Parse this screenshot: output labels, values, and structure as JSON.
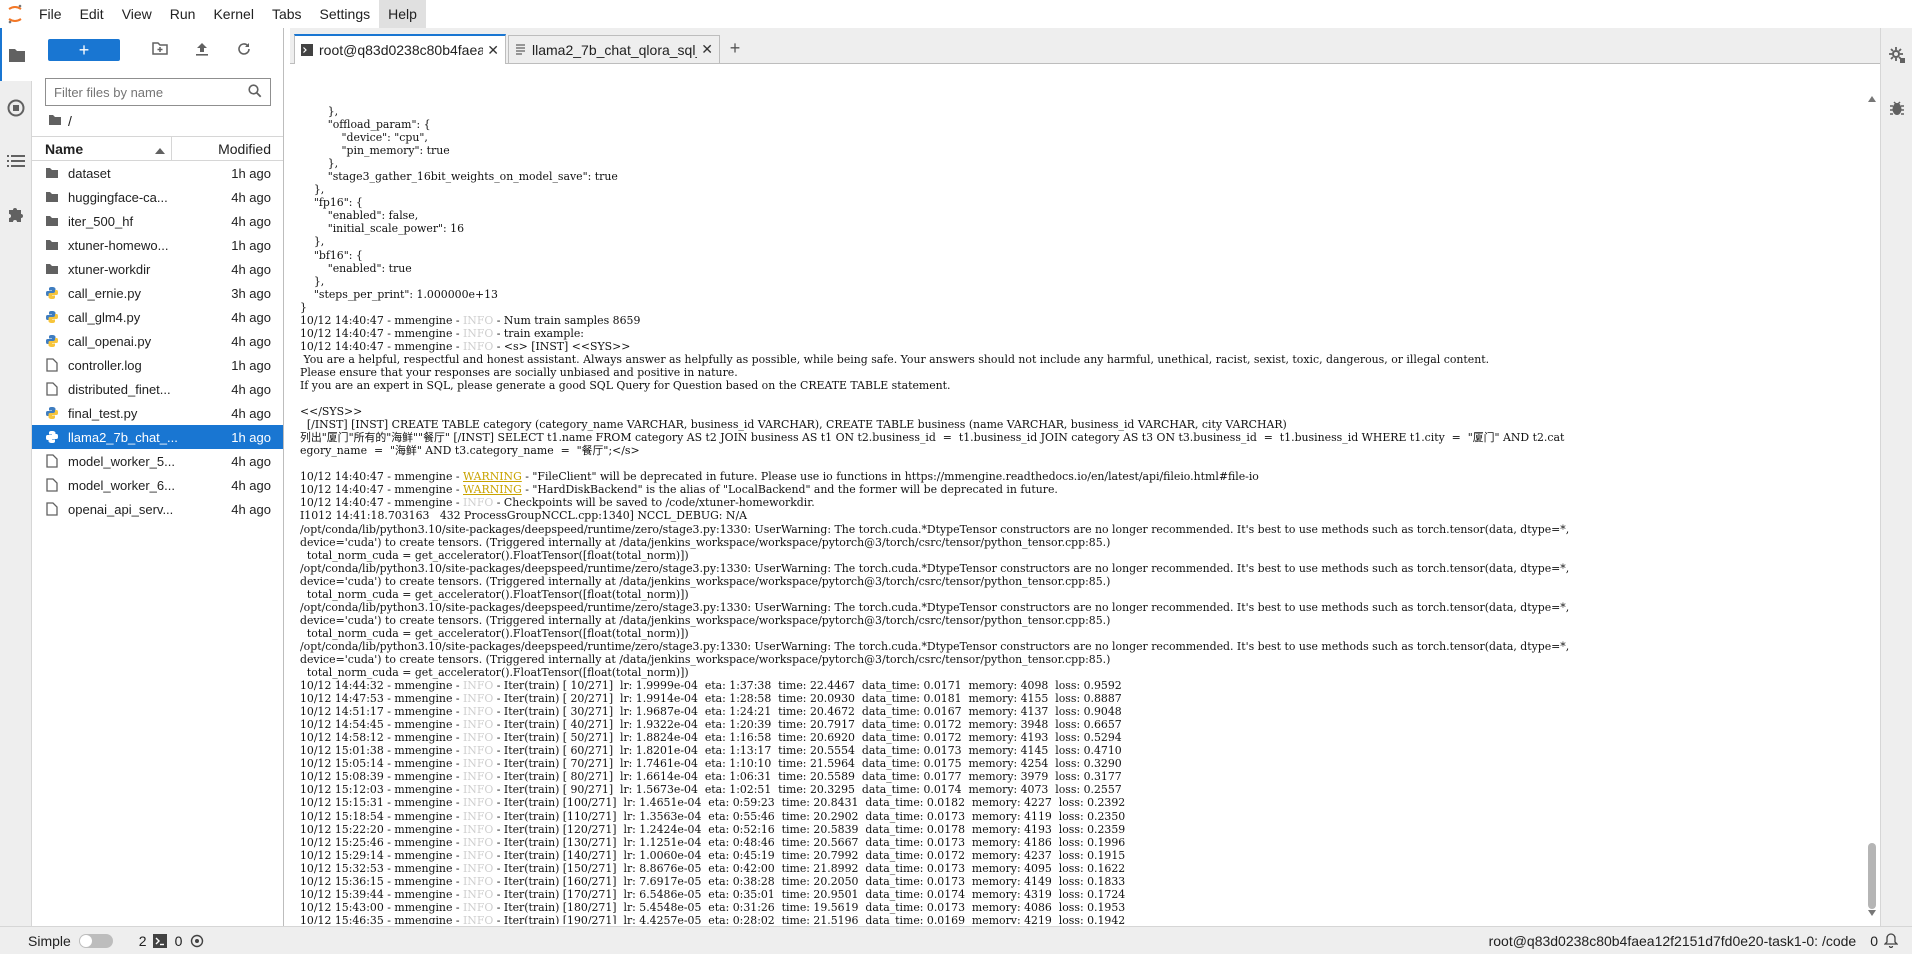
{
  "menu": [
    "File",
    "Edit",
    "View",
    "Run",
    "Kernel",
    "Tabs",
    "Settings",
    "Help"
  ],
  "file_browser": {
    "new_button": "+",
    "filter_placeholder": "Filter files by name",
    "breadcrumb": "/",
    "col_name": "Name",
    "col_modified": "Modified",
    "items": [
      {
        "name": "dataset",
        "type": "folder",
        "modified": "1h ago"
      },
      {
        "name": "huggingface-ca...",
        "type": "folder",
        "modified": "4h ago"
      },
      {
        "name": "iter_500_hf",
        "type": "folder",
        "modified": "4h ago"
      },
      {
        "name": "xtuner-homewo...",
        "type": "folder",
        "modified": "1h ago"
      },
      {
        "name": "xtuner-workdir",
        "type": "folder",
        "modified": "4h ago"
      },
      {
        "name": "call_ernie.py",
        "type": "python",
        "modified": "3h ago"
      },
      {
        "name": "call_glm4.py",
        "type": "python",
        "modified": "4h ago"
      },
      {
        "name": "call_openai.py",
        "type": "python",
        "modified": "4h ago"
      },
      {
        "name": "controller.log",
        "type": "file",
        "modified": "1h ago"
      },
      {
        "name": "distributed_finet...",
        "type": "file",
        "modified": "4h ago"
      },
      {
        "name": "final_test.py",
        "type": "python",
        "modified": "4h ago"
      },
      {
        "name": "llama2_7b_chat_...",
        "type": "python",
        "modified": "1h ago",
        "selected": true
      },
      {
        "name": "model_worker_5...",
        "type": "file",
        "modified": "4h ago"
      },
      {
        "name": "model_worker_6...",
        "type": "file",
        "modified": "4h ago"
      },
      {
        "name": "openai_api_serv...",
        "type": "file",
        "modified": "4h ago"
      }
    ]
  },
  "tabs": [
    {
      "label": "root@q83d0238c80b4faea",
      "type": "terminal",
      "active": true
    },
    {
      "label": "llama2_7b_chat_qlora_sql_",
      "type": "text",
      "active": false
    }
  ],
  "tab_add": "+",
  "terminal_lines": [
    "        },",
    "        \"offload_param\": {",
    "            \"device\": \"cpu\",",
    "            \"pin_memory\": true",
    "        },",
    "        \"stage3_gather_16bit_weights_on_model_save\": true",
    "    },",
    "    \"fp16\": {",
    "        \"enabled\": false,",
    "        \"initial_scale_power\": 16",
    "    },",
    "    \"bf16\": {",
    "        \"enabled\": true",
    "    },",
    "    \"steps_per_print\": 1.000000e+13",
    "}",
    "10/12 14:40:47 - mmengine - [[INFO]] - Num train samples 8659",
    "10/12 14:40:47 - mmengine - [[INFO]] - train example:",
    "10/12 14:40:47 - mmengine - [[INFO]] - <s> [INST] <<SYS>>",
    " You are a helpful, respectful and honest assistant. Always answer as helpfully as possible, while being safe. Your answers should not include any harmful, unethical, racist, sexist, toxic, dangerous, or illegal content.",
    "Please ensure that your responses are socially unbiased and positive in nature.",
    "If you are an expert in SQL, please generate a good SQL Query for Question based on the CREATE TABLE statement.",
    "",
    "<</SYS>>",
    "  [/INST] [INST] CREATE TABLE category (category_name VARCHAR, business_id VARCHAR), CREATE TABLE business (name VARCHAR, business_id VARCHAR, city VARCHAR)",
    "列出\"厦门\"所有的\"海鲜\"\"餐厅\" [/INST] SELECT t1.name FROM category AS t2 JOIN business AS t1 ON t2.business_id  =  t1.business_id JOIN category AS t3 ON t3.business_id  =  t1.business_id WHERE t1.city  =  \"厦门\" AND t2.cat",
    "egory_name  =  \"海鲜\" AND t3.category_name  =  \"餐厅\";</s>",
    "",
    "10/12 14:40:47 - mmengine - [[WARNING]] - \"FileClient\" will be deprecated in future. Please use io functions in https://mmengine.readthedocs.io/en/latest/api/fileio.html#file-io",
    "10/12 14:40:47 - mmengine - [[WARNING]] - \"HardDiskBackend\" is the alias of \"LocalBackend\" and the former will be deprecated in future.",
    "10/12 14:40:47 - mmengine - [[INFO]] - Checkpoints will be saved to /code/xtuner-homeworkdir.",
    "I1012 14:41:18.703163   432 ProcessGroupNCCL.cpp:1340] NCCL_DEBUG: N/A",
    "/opt/conda/lib/python3.10/site-packages/deepspeed/runtime/zero/stage3.py:1330: UserWarning: The torch.cuda.*DtypeTensor constructors are no longer recommended. It's best to use methods such as torch.tensor(data, dtype=*,",
    "device='cuda') to create tensors. (Triggered internally at /data/jenkins_workspace/workspace/pytorch@3/torch/csrc/tensor/python_tensor.cpp:85.)",
    "  total_norm_cuda = get_accelerator().FloatTensor([float(total_norm)])",
    "/opt/conda/lib/python3.10/site-packages/deepspeed/runtime/zero/stage3.py:1330: UserWarning: The torch.cuda.*DtypeTensor constructors are no longer recommended. It's best to use methods such as torch.tensor(data, dtype=*,",
    "device='cuda') to create tensors. (Triggered internally at /data/jenkins_workspace/workspace/pytorch@3/torch/csrc/tensor/python_tensor.cpp:85.)",
    "  total_norm_cuda = get_accelerator().FloatTensor([float(total_norm)])",
    "/opt/conda/lib/python3.10/site-packages/deepspeed/runtime/zero/stage3.py:1330: UserWarning: The torch.cuda.*DtypeTensor constructors are no longer recommended. It's best to use methods such as torch.tensor(data, dtype=*,",
    "device='cuda') to create tensors. (Triggered internally at /data/jenkins_workspace/workspace/pytorch@3/torch/csrc/tensor/python_tensor.cpp:85.)",
    "  total_norm_cuda = get_accelerator().FloatTensor([float(total_norm)])",
    "/opt/conda/lib/python3.10/site-packages/deepspeed/runtime/zero/stage3.py:1330: UserWarning: The torch.cuda.*DtypeTensor constructors are no longer recommended. It's best to use methods such as torch.tensor(data, dtype=*,",
    "device='cuda') to create tensors. (Triggered internally at /data/jenkins_workspace/workspace/pytorch@3/torch/csrc/tensor/python_tensor.cpp:85.)",
    "  total_norm_cuda = get_accelerator().FloatTensor([float(total_norm)])",
    "10/12 14:44:32 - mmengine - [[INFO]] - Iter(train) [ 10/271]  lr: 1.9999e-04  eta: 1:37:38  time: 22.4467  data_time: 0.0171  memory: 4098  loss: 0.9592",
    "10/12 14:47:53 - mmengine - [[INFO]] - Iter(train) [ 20/271]  lr: 1.9914e-04  eta: 1:28:58  time: 20.0930  data_time: 0.0181  memory: 4155  loss: 0.8887",
    "10/12 14:51:17 - mmengine - [[INFO]] - Iter(train) [ 30/271]  lr: 1.9687e-04  eta: 1:24:21  time: 20.4672  data_time: 0.0167  memory: 4137  loss: 0.9048",
    "10/12 14:54:45 - mmengine - [[INFO]] - Iter(train) [ 40/271]  lr: 1.9322e-04  eta: 1:20:39  time: 20.7917  data_time: 0.0172  memory: 3948  loss: 0.6657",
    "10/12 14:58:12 - mmengine - [[INFO]] - Iter(train) [ 50/271]  lr: 1.8824e-04  eta: 1:16:58  time: 20.6920  data_time: 0.0172  memory: 4193  loss: 0.5294",
    "10/12 15:01:38 - mmengine - [[INFO]] - Iter(train) [ 60/271]  lr: 1.8201e-04  eta: 1:13:17  time: 20.5554  data_time: 0.0173  memory: 4145  loss: 0.4710",
    "10/12 15:05:14 - mmengine - [[INFO]] - Iter(train) [ 70/271]  lr: 1.7461e-04  eta: 1:10:10  time: 21.5964  data_time: 0.0175  memory: 4254  loss: 0.3290",
    "10/12 15:08:39 - mmengine - [[INFO]] - Iter(train) [ 80/271]  lr: 1.6614e-04  eta: 1:06:31  time: 20.5589  data_time: 0.0177  memory: 3979  loss: 0.3177",
    "10/12 15:12:03 - mmengine - [[INFO]] - Iter(train) [ 90/271]  lr: 1.5673e-04  eta: 1:02:51  time: 20.3295  data_time: 0.0174  memory: 4073  loss: 0.2557",
    "10/12 15:15:31 - mmengine - [[INFO]] - Iter(train) [100/271]  lr: 1.4651e-04  eta: 0:59:23  time: 20.8431  data_time: 0.0182  memory: 4227  loss: 0.2392",
    "10/12 15:18:54 - mmengine - [[INFO]] - Iter(train) [110/271]  lr: 1.3563e-04  eta: 0:55:46  time: 20.2902  data_time: 0.0173  memory: 4119  loss: 0.2350",
    "10/12 15:22:20 - mmengine - [[INFO]] - Iter(train) [120/271]  lr: 1.2424e-04  eta: 0:52:16  time: 20.5839  data_time: 0.0178  memory: 4193  loss: 0.2359",
    "10/12 15:25:46 - mmengine - [[INFO]] - Iter(train) [130/271]  lr: 1.1251e-04  eta: 0:48:46  time: 20.5667  data_time: 0.0173  memory: 4186  loss: 0.1996",
    "10/12 15:29:14 - mmengine - [[INFO]] - Iter(train) [140/271]  lr: 1.0060e-04  eta: 0:45:19  time: 20.7992  data_time: 0.0172  memory: 4237  loss: 0.1915",
    "10/12 15:32:53 - mmengine - [[INFO]] - Iter(train) [150/271]  lr: 8.8676e-05  eta: 0:42:00  time: 21.8992  data_time: 0.0173  memory: 4095  loss: 0.1622",
    "10/12 15:36:15 - mmengine - [[INFO]] - Iter(train) [160/271]  lr: 7.6917e-05  eta: 0:38:28  time: 20.2050  data_time: 0.0173  memory: 4149  loss: 0.1833",
    "10/12 15:39:44 - mmengine - [[INFO]] - Iter(train) [170/271]  lr: 6.5486e-05  eta: 0:35:01  time: 20.9501  data_time: 0.0174  memory: 4319  loss: 0.1724",
    "10/12 15:43:00 - mmengine - [[INFO]] - Iter(train) [180/271]  lr: 5.4548e-05  eta: 0:31:26  time: 19.5619  data_time: 0.0173  memory: 4086  loss: 0.1953",
    "10/12 15:46:35 - mmengine - [[INFO]] - Iter(train) [190/271]  lr: 4.4257e-05  eta: 0:28:02  time: 21.5196  data_time: 0.0169  memory: 4219  loss: 0.1942"
  ],
  "status": {
    "mode_label": "Simple",
    "count_terminals": "2",
    "count_kernels": "0",
    "right_text": "root@q83d0238c80b4faea12f2151d7fd0e20-task1-0: /code",
    "right_count": "0"
  },
  "colors": {
    "accent": "#1976d2",
    "warning": "#c9a300",
    "logo": "#f37726"
  }
}
